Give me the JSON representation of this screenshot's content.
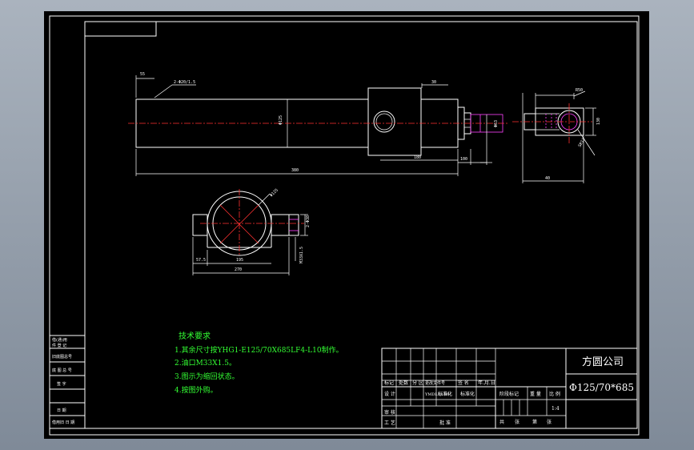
{
  "tech_requirements": {
    "title": "技术要求",
    "items": [
      "1.其余尺寸按YHG1-E125/70X685LF4-L10制作。",
      "2.油口M33X1.5。",
      "3.图示为缩回状态。",
      "4.按图外购。"
    ]
  },
  "title_block": {
    "company": "方圆公司",
    "drawing_name": "Φ125/70*685",
    "scale": "1:4",
    "labels": {
      "biaoji": "标记",
      "chushu": "处数",
      "fenqu": "分 区",
      "genggai": "更改文件号",
      "qianming": "签 名",
      "nianyueri": "年.月.日",
      "sheji": "设 计",
      "biaozhunhua": "标准化",
      "jieduan": "阶段标记",
      "zhongliang": "重 量",
      "bili": "比 例",
      "shenhe": "审 核",
      "gongyi": "工 艺",
      "pizhun": "批 准",
      "gong": "共",
      "zhang1": "张",
      "di": "第",
      "zhang2": "张"
    },
    "design_date": "YMDL13.89",
    "designer_mark": "标准化"
  },
  "left_strip": {
    "rows": [
      "借(通)用",
      "件 登 记",
      "旧底图总号",
      "底 图 总 号",
      "签 字",
      "日 期",
      "借用旧 日 期"
    ]
  },
  "dims": {
    "d1": "55",
    "d2": "2-Φ20/1.5",
    "d3": "30",
    "d4": "Φ125",
    "d5": "380",
    "d6": "180",
    "d7": "100",
    "d8": "Φ63",
    "d9": "SR13",
    "d10": "40",
    "d11": "130",
    "d12": "R50",
    "d13": "Φ125",
    "d14": "195",
    "d15": "M33X1.5",
    "d16": "2-Φ38",
    "d17": "57.5",
    "d18": "Φ160",
    "d19": "270"
  }
}
